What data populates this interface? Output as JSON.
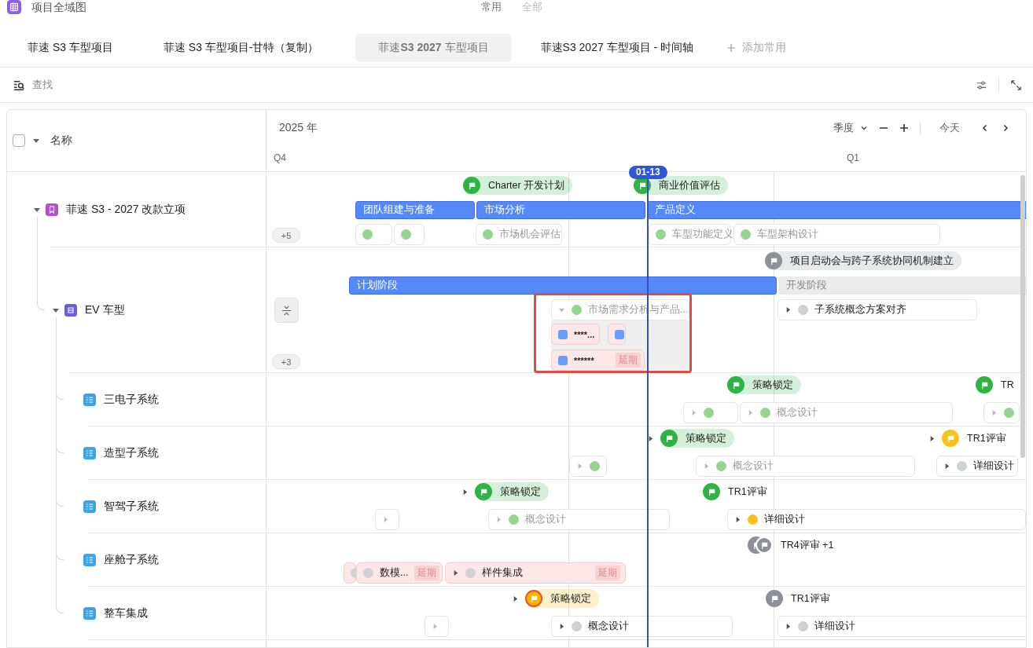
{
  "app": {
    "title": "项目全域图",
    "views": [
      {
        "label": "常用",
        "selected": true
      },
      {
        "label": "全部",
        "selected": false
      }
    ]
  },
  "tabs": [
    {
      "label": "菲速 S3 车型项目",
      "selected": false
    },
    {
      "label": "菲速 S3 车型项目-甘特（复制）",
      "selected": false
    },
    {
      "label": "菲速**S3 2027** 车型项目",
      "selected": true
    },
    {
      "label": "菲速S3 2027 车型项目 - 时间轴",
      "selected": false
    }
  ],
  "add_tab": "添加常用",
  "toolbar": {
    "search": "查找"
  },
  "gantt": {
    "name_header": "名称",
    "select_all": false,
    "year": "2025 年",
    "scale": "季度",
    "today_button": "今天",
    "quarters": [
      "Q4",
      "Q1"
    ],
    "today_marker": "01-13"
  },
  "tree": [
    {
      "name": "菲速 S3 - 2027 改款立项",
      "kind": "project",
      "expanded": true,
      "items": [
        {
          "kind": "milestone",
          "label": "Charter 开发计划",
          "color": "#2fb344",
          "tinted": true,
          "expandable": false,
          "stacked": false,
          "overdue": false
        },
        {
          "kind": "milestone",
          "label": "商业价值评估",
          "color": "#2fb344",
          "tinted": true,
          "expandable": false,
          "stacked": false,
          "overdue": false
        },
        {
          "kind": "phase",
          "label": "团队组建与准备",
          "active": true
        },
        {
          "kind": "phase",
          "label": "市场分析",
          "active": true
        },
        {
          "kind": "phase",
          "label": "产品定义",
          "active": true
        },
        {
          "kind": "more",
          "label": "+5"
        },
        {
          "kind": "task",
          "color": "#97d48f",
          "expandable": false,
          "delayed": false
        },
        {
          "kind": "task",
          "color": "#97d48f",
          "expandable": false,
          "delayed": false
        },
        {
          "kind": "task",
          "label": "市场机会评估",
          "color": "#97d48f",
          "completed": true,
          "expandable": false,
          "delayed": false
        },
        {
          "kind": "task",
          "label": "车型功能定义",
          "color": "#97d48f",
          "completed": true,
          "expandable": false,
          "delayed": false
        },
        {
          "kind": "task",
          "label": "车型架构设计",
          "color": "#97d48f",
          "completed": true,
          "expandable": false,
          "delayed": false
        }
      ],
      "children": [
        {
          "name": "EV 车型",
          "kind": "model",
          "expanded": true,
          "items": [
            {
              "kind": "milestone",
              "label": "项目启动会与跨子系统协同机制建立",
              "color": "#8d9097",
              "tinted": true,
              "expandable": false,
              "stacked": false,
              "overdue": false
            },
            {
              "kind": "phase",
              "label": "计划阶段",
              "active": true
            },
            {
              "kind": "phase",
              "label": "开发阶段",
              "active": false
            },
            {
              "kind": "collapse"
            },
            {
              "kind": "task-group",
              "label": "市场需求分析与产品...",
              "color": "#97d48f",
              "completed": true,
              "expanded": true,
              "selected": true,
              "children": [
                {
                  "label": "****...",
                  "delayed": true
                },
                {
                  "delayed": true
                },
                {
                  "label": "******",
                  "delayed": true,
                  "tag": "延期"
                }
              ]
            },
            {
              "kind": "task",
              "label": "子系统概念方案对齐",
              "color": "#cfd1d5",
              "completed": false,
              "expandable": true,
              "delayed": false
            },
            {
              "kind": "more",
              "label": "+3"
            }
          ],
          "children": [
            {
              "name": "三电子系统",
              "kind": "subsystem",
              "items": [
                {
                  "kind": "milestone",
                  "label": "策略锁定",
                  "color": "#2fb344",
                  "tinted": true,
                  "expandable": false,
                  "stacked": false,
                  "overdue": false
                },
                {
                  "kind": "milestone",
                  "label": "TR",
                  "color": "#2fb344",
                  "tinted": false,
                  "expandable": false,
                  "stacked": false,
                  "overdue": false
                },
                {
                  "kind": "task",
                  "color": "#97d48f",
                  "expandable": true,
                  "delayed": false
                },
                {
                  "kind": "task",
                  "label": "概念设计",
                  "color": "#97d48f",
                  "completed": true,
                  "expandable": true,
                  "delayed": false
                },
                {
                  "kind": "task",
                  "color": "#97d48f",
                  "expandable": true,
                  "delayed": false
                }
              ]
            },
            {
              "name": "造型子系统",
              "kind": "subsystem",
              "items": [
                {
                  "kind": "milestone",
                  "label": "策略锁定",
                  "color": "#2fb344",
                  "tinted": true,
                  "expandable": true,
                  "stacked": false,
                  "overdue": false
                },
                {
                  "kind": "milestone",
                  "label": "TR1评审",
                  "color": "#f7c21b",
                  "tinted": false,
                  "expandable": true,
                  "stacked": false,
                  "overdue": false
                },
                {
                  "kind": "task",
                  "color": "#97d48f",
                  "expandable": true,
                  "delayed": false
                },
                {
                  "kind": "task",
                  "label": "概念设计",
                  "color": "#97d48f",
                  "completed": true,
                  "expandable": true,
                  "delayed": false
                },
                {
                  "kind": "task",
                  "label": "详细设计",
                  "color": "#cfd1d5",
                  "completed": false,
                  "expandable": true,
                  "delayed": false
                }
              ]
            },
            {
              "name": "智驾子系统",
              "kind": "subsystem",
              "items": [
                {
                  "kind": "milestone",
                  "label": "策略锁定",
                  "color": "#2fb344",
                  "tinted": true,
                  "expandable": true,
                  "stacked": false,
                  "overdue": false
                },
                {
                  "kind": "milestone",
                  "label": "TR1评审",
                  "color": "#2fb344",
                  "tinted": false,
                  "expandable": false,
                  "stacked": false,
                  "overdue": false
                },
                {
                  "kind": "task",
                  "expandable": true,
                  "delayed": false
                },
                {
                  "kind": "task",
                  "label": "概念设计",
                  "color": "#97d48f",
                  "completed": true,
                  "expandable": true,
                  "delayed": false
                },
                {
                  "kind": "task",
                  "label": "详细设计",
                  "color": "#f7c21b",
                  "completed": false,
                  "expandable": true,
                  "delayed": false
                }
              ]
            },
            {
              "name": "座舱子系统",
              "kind": "subsystem",
              "items": [
                {
                  "kind": "milestone",
                  "label": "TR4评审 +1",
                  "color": "#8d9097",
                  "tinted": false,
                  "expandable": false,
                  "stacked": true,
                  "overdue": false
                },
                {
                  "kind": "task",
                  "color": "#cfd1d5",
                  "expandable": false,
                  "delayed": true
                },
                {
                  "kind": "task",
                  "label": "数模...",
                  "color": "#cfd1d5",
                  "completed": false,
                  "expandable": false,
                  "delayed": true,
                  "tag": "延期"
                },
                {
                  "kind": "task",
                  "label": "样件集成",
                  "color": "#cfd1d5",
                  "completed": false,
                  "expandable": true,
                  "delayed": true,
                  "tag": "延期"
                }
              ]
            },
            {
              "name": "整车集成",
              "kind": "subsystem",
              "items": [
                {
                  "kind": "milestone",
                  "label": "策略锁定",
                  "color": "#f7b500",
                  "tinted": true,
                  "expandable": true,
                  "stacked": false,
                  "overdue": true
                },
                {
                  "kind": "milestone",
                  "label": "TR1评审",
                  "color": "#8d9097",
                  "tinted": false,
                  "expandable": false,
                  "stacked": false,
                  "overdue": false
                },
                {
                  "kind": "task",
                  "expandable": true,
                  "delayed": false
                },
                {
                  "kind": "task",
                  "label": "概念设计",
                  "color": "#cfd1d5",
                  "completed": false,
                  "expandable": true,
                  "delayed": false
                },
                {
                  "kind": "task",
                  "label": "详细设计",
                  "color": "#cfd1d5",
                  "completed": false,
                  "expandable": true,
                  "delayed": false
                }
              ]
            }
          ]
        }
      ]
    }
  ]
}
